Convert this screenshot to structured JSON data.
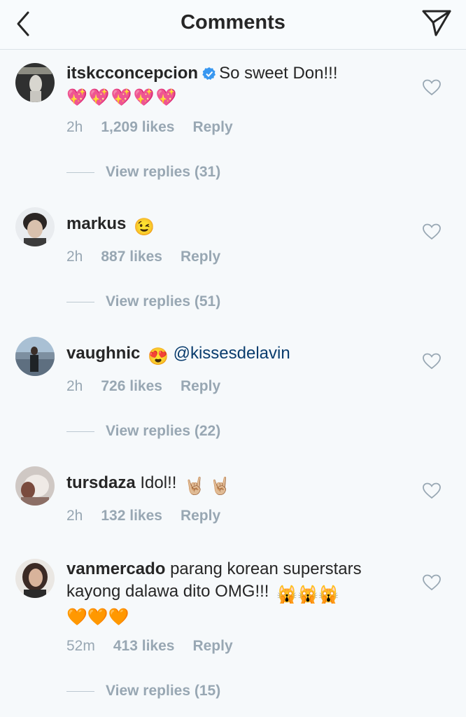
{
  "header": {
    "title": "Comments",
    "back_icon": "chevron-left-icon",
    "send_icon": "paper-plane-icon"
  },
  "comments": [
    {
      "username": "itskcconcepcion",
      "verified": true,
      "text": "So sweet Don!!!",
      "emoji_line": "💖💖💖💖💖",
      "time": "2h",
      "likes": "1,209 likes",
      "reply": "Reply",
      "view_replies": "View replies (31)"
    },
    {
      "username": "markus",
      "text": "😉",
      "time": "2h",
      "likes": "887 likes",
      "reply": "Reply",
      "view_replies": "View replies (51)"
    },
    {
      "username": "vaughnic",
      "emoji": "😍",
      "mention": "@kissesdelavin",
      "time": "2h",
      "likes": "726 likes",
      "reply": "Reply",
      "view_replies": "View replies (22)"
    },
    {
      "username": "tursdaza",
      "text": "Idol!!",
      "emoji": "🤘🏼 🤘🏼",
      "time": "2h",
      "likes": "132 likes",
      "reply": "Reply"
    },
    {
      "username": "vanmercado",
      "text_line1": "parang korean superstars",
      "text_line2": "kayong dalawa dito OMG!!!",
      "emoji": "🙀🙀🙀",
      "emoji_line": "🧡🧡🧡",
      "time": "52m",
      "likes": "413 likes",
      "reply": "Reply",
      "view_replies": "View replies (15)"
    }
  ],
  "colors": {
    "background": "#f6f9fb",
    "text": "#262626",
    "meta": "#98a7b3",
    "mention": "#0a3d6e",
    "verified": "#3897f0"
  }
}
